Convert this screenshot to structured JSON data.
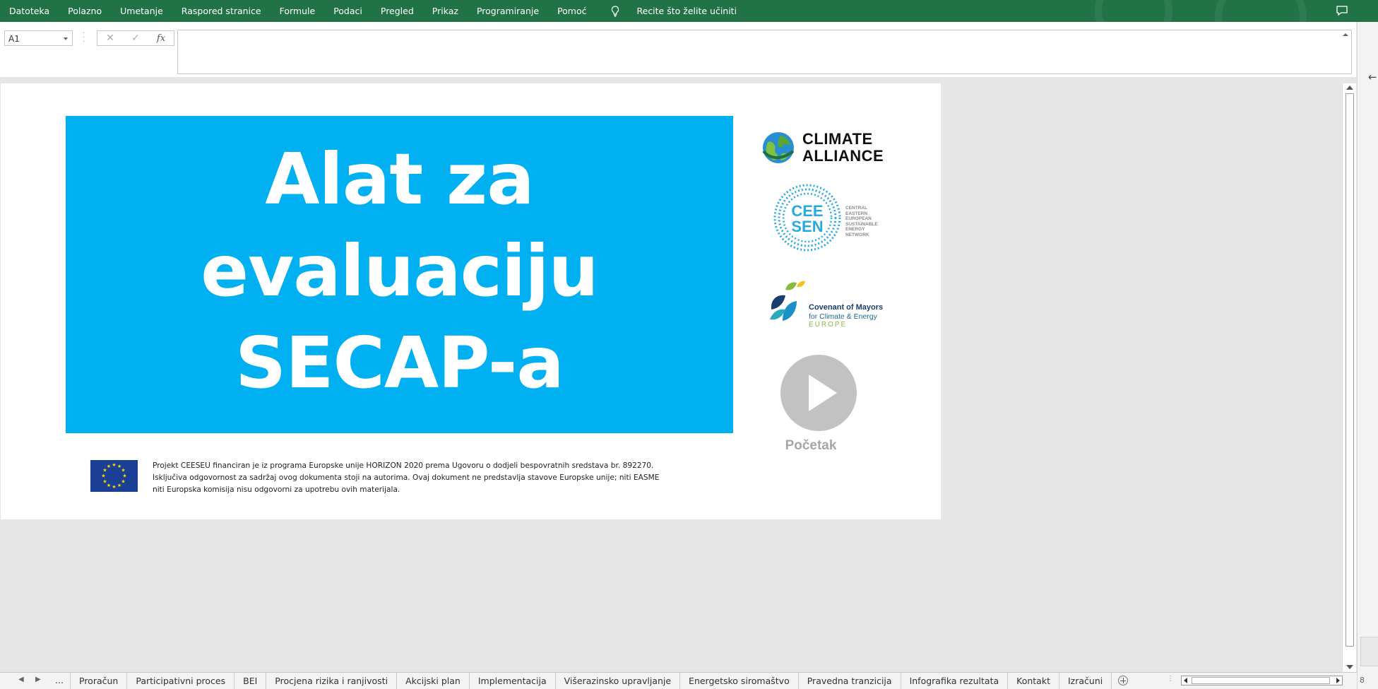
{
  "ribbon": {
    "menu": [
      "Datoteka",
      "Polazno",
      "Umetanje",
      "Raspored stranice",
      "Formule",
      "Podaci",
      "Pregled",
      "Prikaz",
      "Programiranje",
      "Pomoć"
    ],
    "tell_me": "Recite što želite učiniti"
  },
  "formula_bar": {
    "name_box": "A1",
    "formula": ""
  },
  "title": {
    "line1": "Alat za evaluaciju",
    "line2": "SECAP-a"
  },
  "logos": {
    "climate_alliance": {
      "line1": "CLIMATE",
      "line2": "ALLIANCE"
    },
    "ceesen": {
      "mark": "CEE SEN",
      "small": [
        "CENTRAL",
        "EASTERN",
        "EUROPEAN",
        "SUSTAINABLE",
        "ENERGY",
        "NETWORK"
      ]
    },
    "covenant": {
      "line1": "Covenant of Mayors",
      "line2": "for Climate & Energy",
      "line3": "EUROPE"
    }
  },
  "start_button": {
    "label": "Početak"
  },
  "disclaimer": [
    "Projekt CEESEU financiran je iz programa Europske unije HORIZON 2020 prema Ugovoru o dodjeli bespovratnih sredstava br. 892270.",
    "Isključiva odgovornost za sadržaj ovog dokumenta stoji na autorima. Ovaj dokument ne predstavlja stavove Europske unije; niti EASME",
    "niti Europska komisija nisu odgovorni za upotrebu ovih materijala."
  ],
  "sheet_tabs": {
    "ellipsis": "...",
    "tabs": [
      "Proračun",
      "Participativni proces",
      "BEI",
      "Procjena rizika i ranjivosti",
      "Akcijski plan",
      "Implementacija",
      "Višerazinsko upravljanje",
      "Energetsko siromaštvo",
      "Pravedna tranzicija",
      "Infografika rezultata",
      "Kontakt",
      "Izračuni"
    ]
  },
  "status": {
    "zoom_fragment": "8"
  },
  "colors": {
    "ribbon": "#217346",
    "banner": "#00b0f0",
    "eu_blue": "#1b3f95",
    "play": "#c2c2c2"
  }
}
